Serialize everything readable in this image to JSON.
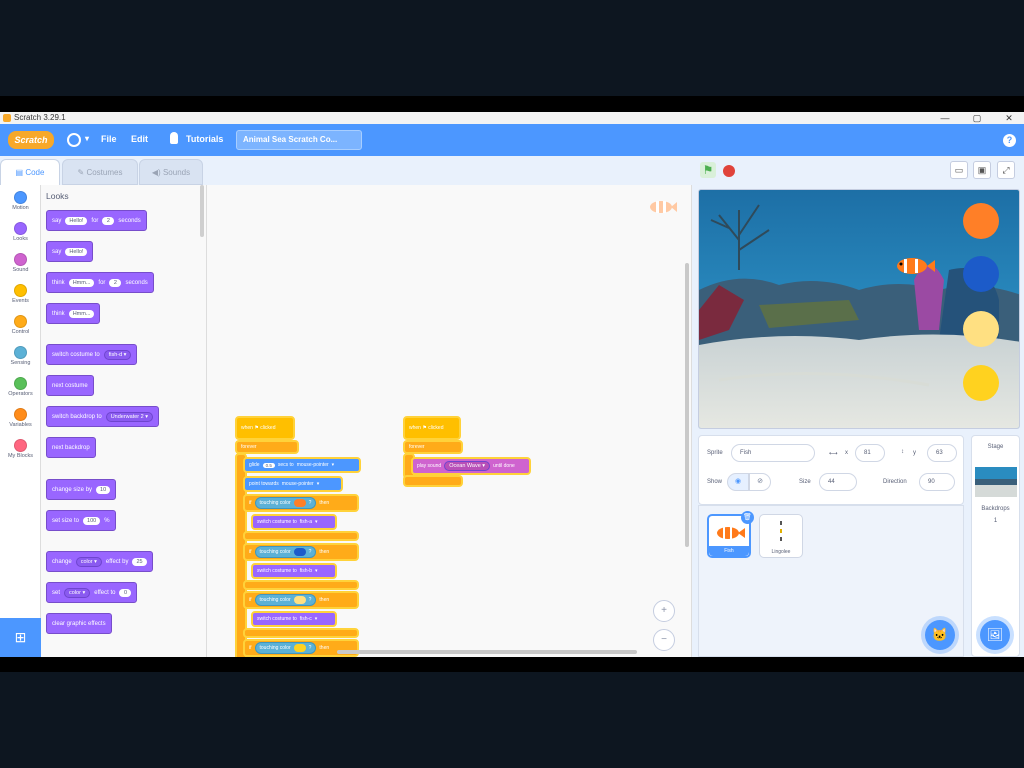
{
  "window": {
    "title": "Scratch 3.29.1",
    "minimize": "—",
    "maximize": "▢",
    "close": "✕"
  },
  "menubar": {
    "logo": "Scratch",
    "file": "File",
    "edit": "Edit",
    "tutorials": "Tutorials",
    "project_title": "Animal Sea Scratch Co..."
  },
  "tabs": {
    "code": "Code",
    "costumes": "Costumes",
    "sounds": "Sounds"
  },
  "categories": [
    {
      "label": "Motion",
      "color": "#4c97ff"
    },
    {
      "label": "Looks",
      "color": "#9966ff"
    },
    {
      "label": "Sound",
      "color": "#cf63cf"
    },
    {
      "label": "Events",
      "color": "#ffbf00"
    },
    {
      "label": "Control",
      "color": "#ffab19"
    },
    {
      "label": "Sensing",
      "color": "#5cb1d6"
    },
    {
      "label": "Operators",
      "color": "#59c059"
    },
    {
      "label": "Variables",
      "color": "#ff8c1a"
    },
    {
      "label": "My Blocks",
      "color": "#ff6680"
    }
  ],
  "palette": {
    "title": "Looks",
    "say_for": {
      "a": "say",
      "msg": "Hello!",
      "b": "for",
      "secs": "2",
      "c": "seconds"
    },
    "say": {
      "a": "say",
      "msg": "Hello!"
    },
    "think_for": {
      "a": "think",
      "msg": "Hmm...",
      "b": "for",
      "secs": "2",
      "c": "seconds"
    },
    "think": {
      "a": "think",
      "msg": "Hmm..."
    },
    "switch_costume": {
      "a": "switch costume to",
      "val": "fish-d"
    },
    "next_costume": "next costume",
    "switch_backdrop": {
      "a": "switch backdrop to",
      "val": "Underwater 2"
    },
    "next_backdrop": "next backdrop",
    "change_size": {
      "a": "change size by",
      "val": "10"
    },
    "set_size": {
      "a": "set size to",
      "val": "100",
      "b": "%"
    },
    "change_effect": {
      "a": "change",
      "effect": "color",
      "b": "effect by",
      "val": "25"
    },
    "set_effect": {
      "a": "set",
      "effect": "color",
      "b": "effect to",
      "val": "0"
    },
    "clear_effects": "clear graphic effects"
  },
  "script1": {
    "hat": "when ⚑ clicked",
    "forever": "forever",
    "glide": {
      "a": "glide",
      "secs": "0.5",
      "b": "secs to",
      "target": "mouse-pointer"
    },
    "point": {
      "a": "point towards",
      "target": "mouse-pointer"
    },
    "if_label": "if",
    "then_label": "then",
    "touching": "touching color",
    "switch": {
      "a": "switch costume to"
    },
    "ifs": [
      {
        "color": "#ff7f27",
        "costume": "fish-a"
      },
      {
        "color": "#1c5bc9",
        "costume": "fish-b"
      },
      {
        "color": "#ffe082",
        "costume": "fish-c"
      },
      {
        "color": "#ffd21f",
        "costume": "fish-d"
      }
    ]
  },
  "script2": {
    "hat": "when ⚑ clicked",
    "forever": "forever",
    "play": {
      "a": "play sound",
      "sound": "Ocean Wave",
      "b": "until done"
    }
  },
  "zoom": {
    "in": "+",
    "out": "−",
    "reset": "="
  },
  "stage_buttons": [
    {
      "name": "orange-circle",
      "color": "#ff7f27"
    },
    {
      "name": "blue-circle",
      "color": "#1c5bc9"
    },
    {
      "name": "light-yellow-circle",
      "color": "#ffe082"
    },
    {
      "name": "yellow-circle",
      "color": "#ffd21f"
    }
  ],
  "sprite_info": {
    "sprite_label": "Sprite",
    "sprite_name": "Fish",
    "x_label": "x",
    "x": "81",
    "y_label": "y",
    "y": "63",
    "show_label": "Show",
    "size_label": "Size",
    "size": "44",
    "direction_label": "Direction",
    "direction": "90"
  },
  "sprites": [
    {
      "name": "Fish"
    },
    {
      "name": "Lingolee"
    }
  ],
  "stage_panel": {
    "title": "Stage",
    "backdrops_label": "Backdrops",
    "backdrops_count": "1"
  }
}
